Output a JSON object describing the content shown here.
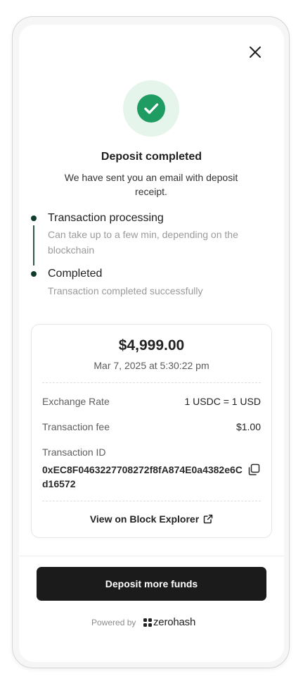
{
  "dialog": {
    "close_icon": "close-icon",
    "status_icon": "check-circle-icon",
    "title": "Deposit completed",
    "subtitle": "We have sent you an email with deposit receipt."
  },
  "steps": [
    {
      "title": "Transaction processing",
      "desc": "Can take up to a few min, depending on the blockchain"
    },
    {
      "title": "Completed",
      "desc": "Transaction completed successfully"
    }
  ],
  "receipt": {
    "amount": "$4,999.00",
    "date": "Mar 7, 2025 at 5:30:22 pm",
    "exchange_rate_label": "Exchange Rate",
    "exchange_rate_value": "1 USDC = 1 USD",
    "fee_label": "Transaction fee",
    "fee_value": "$1.00",
    "txid_label": "Transaction ID",
    "txid_value": "0xEC8F0463227708272f8fA874E0a4382e6Cd16572",
    "copy_icon": "copy-icon",
    "explorer_label": "View on Block Explorer",
    "explorer_icon": "external-link-icon"
  },
  "footer": {
    "button_label": "Deposit more funds",
    "powered_by": "Powered by",
    "brand_name": "zerohash"
  },
  "colors": {
    "success": "#1e9c62",
    "success_bg": "#e6f5ec",
    "step_dot": "#0f3d2a",
    "button_bg": "#1b1b1b"
  }
}
